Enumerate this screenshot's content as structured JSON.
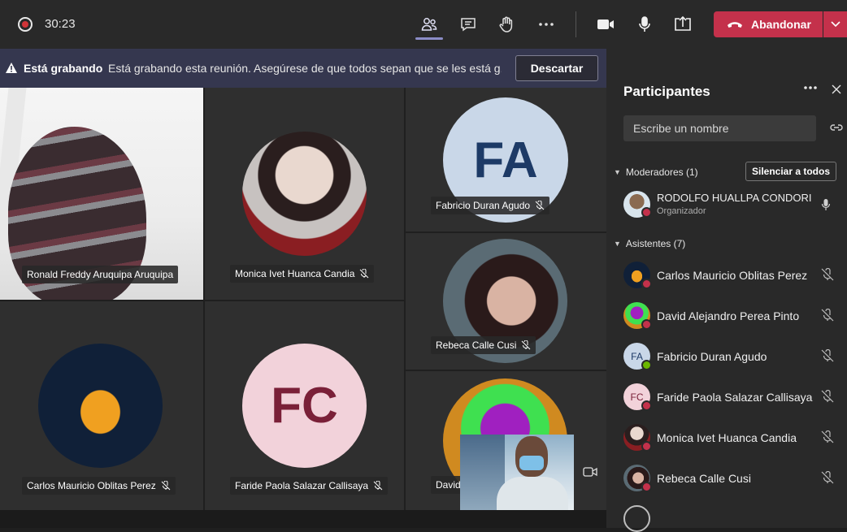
{
  "topbar": {
    "timer": "30:23",
    "leave_label": "Abandonar"
  },
  "banner": {
    "title": "Está grabando",
    "text": "Está grabando esta reunión. Asegúrese de que todos sepan que se les está g...",
    "dismiss_label": "Descartar"
  },
  "tiles": [
    {
      "name": "Ronald Freddy Aruquipa Aruquipa"
    },
    {
      "name": "Monica Ivet Huanca Candia"
    },
    {
      "name": "Fabricio Duran Agudo",
      "initials": "FA"
    },
    {
      "name": "Rebeca Calle Cusi"
    },
    {
      "name": "Carlos Mauricio Oblitas Perez"
    },
    {
      "name": "Faride Paola Salazar Callisaya",
      "initials": "FC"
    },
    {
      "name": "David"
    }
  ],
  "panel": {
    "title": "Participantes",
    "search_placeholder": "Escribe un nombre",
    "moderators_label": "Moderadores (1)",
    "mute_all_label": "Silenciar a todos",
    "attendees_label": "Asistentes (7)",
    "moderator": {
      "name": "RODOLFO HUALLPA CONDORI",
      "role": "Organizador"
    },
    "attendees": [
      {
        "name": "Carlos Mauricio Oblitas Perez"
      },
      {
        "name": "David Alejandro Perea Pinto"
      },
      {
        "name": "Fabricio Duran Agudo",
        "initials": "FA"
      },
      {
        "name": "Faride Paola Salazar Callisaya",
        "initials": "FC"
      },
      {
        "name": "Monica Ivet Huanca Candia"
      },
      {
        "name": "Rebeca Calle Cusi"
      }
    ]
  },
  "colors": {
    "accent": "#8b8cc7",
    "leave": "#c4314b",
    "recording": "#d13438",
    "banner": "#35374f",
    "fa_bg": "#c9d7e8",
    "fa_text": "#1d3a66",
    "fc_bg": "#f2d2da",
    "fc_text": "#7a2038"
  }
}
